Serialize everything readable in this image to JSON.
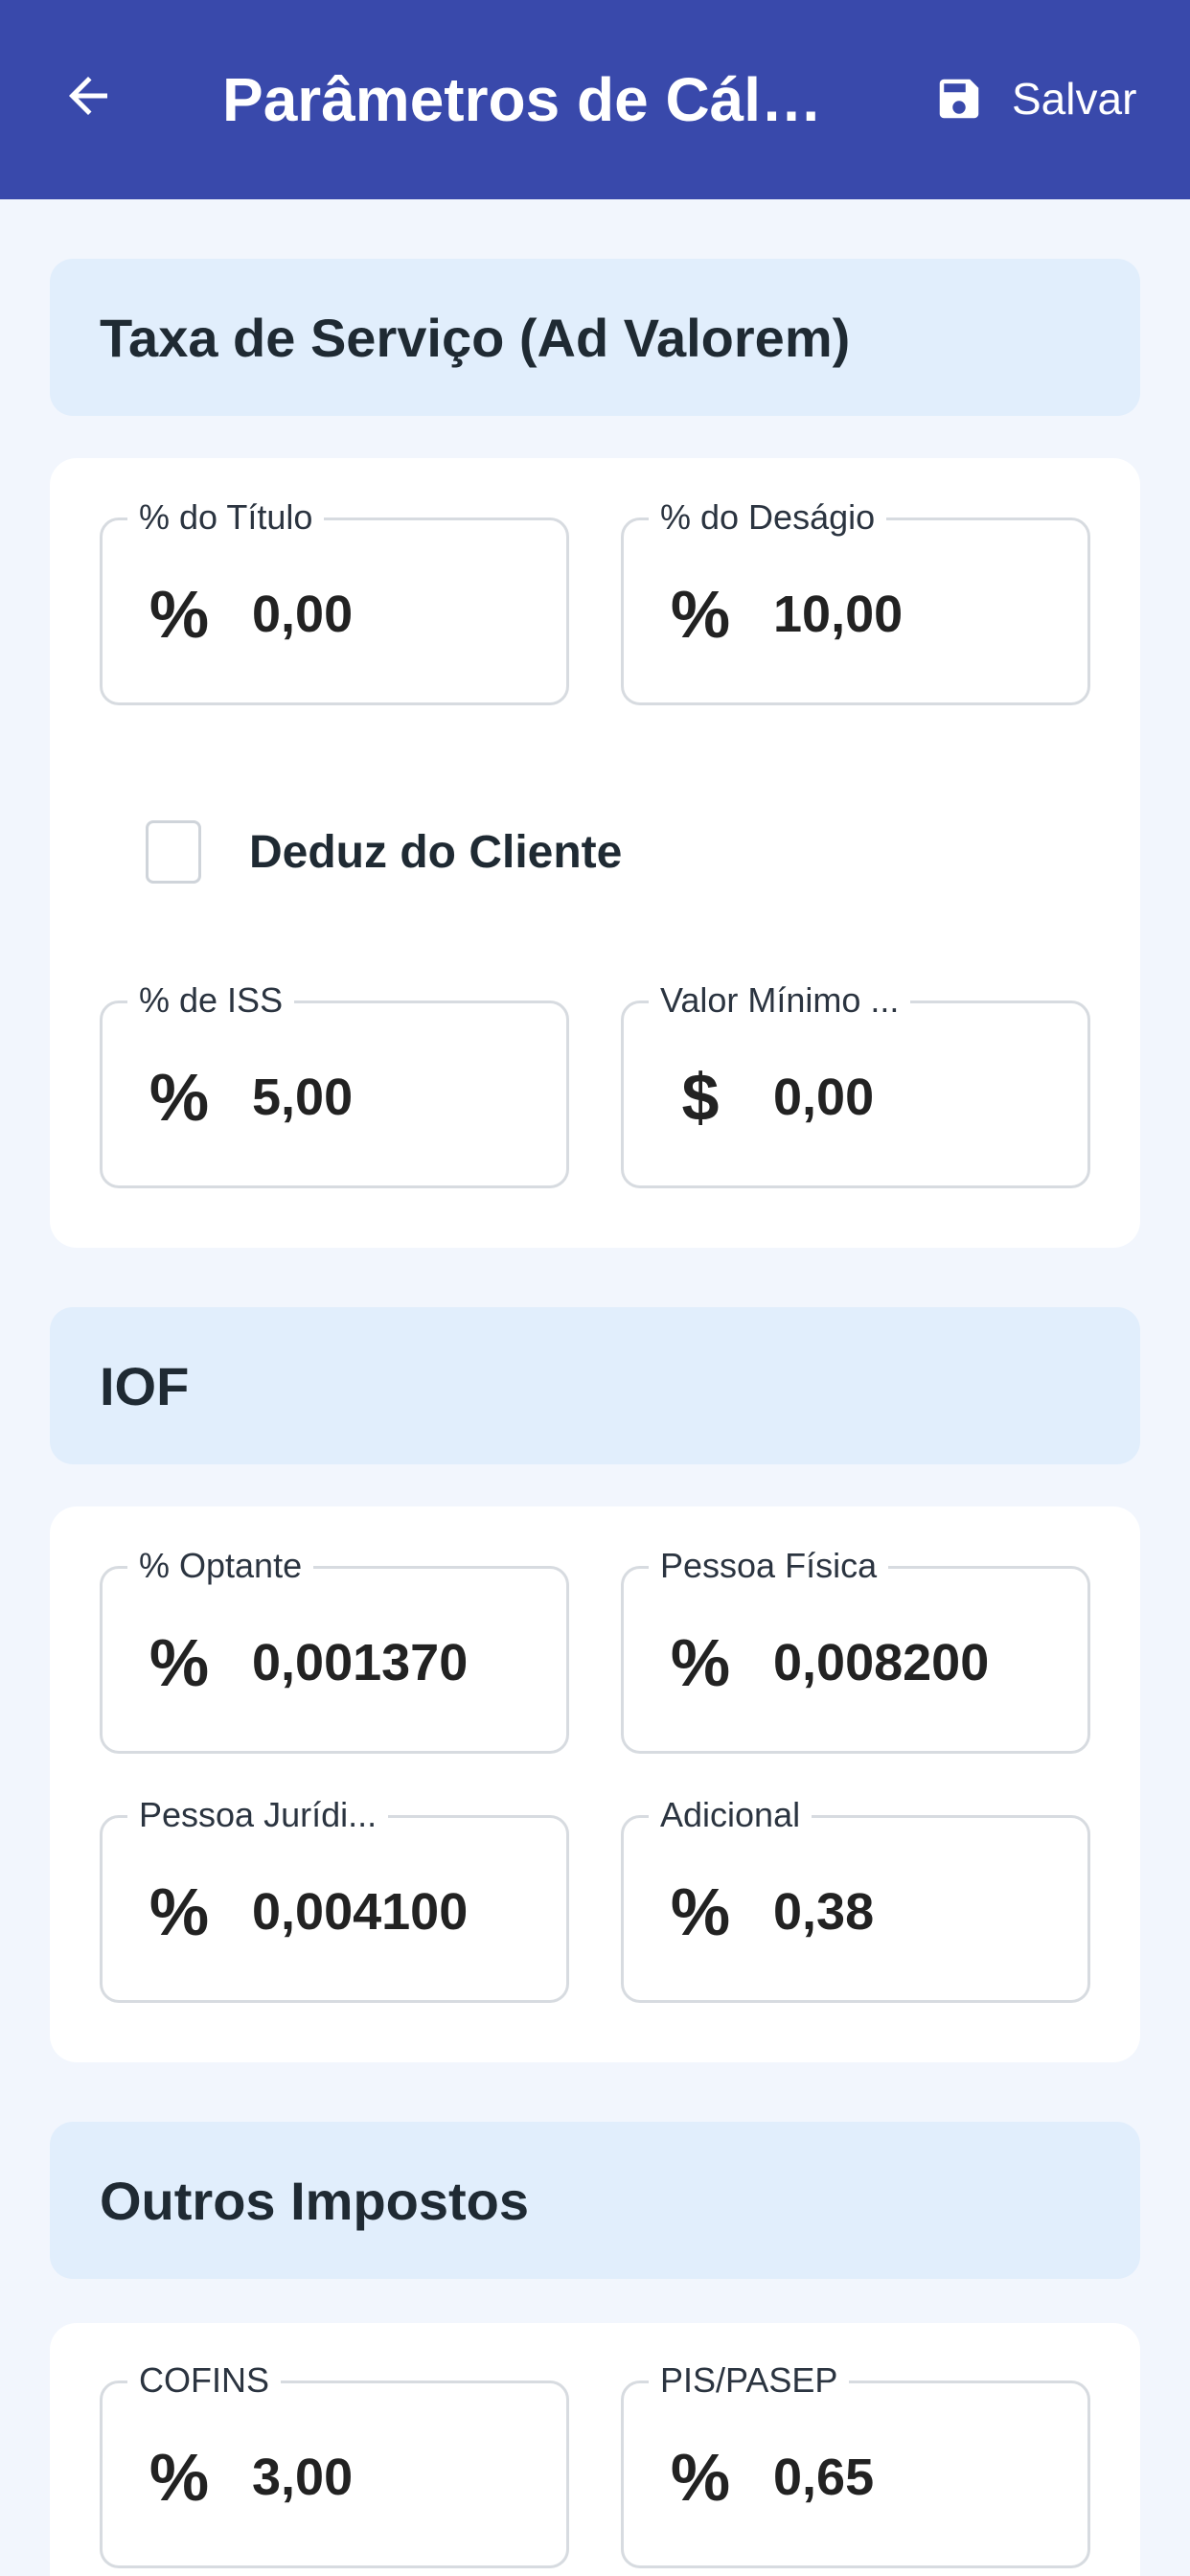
{
  "appbar": {
    "title": "Parâmetros de Cálcu...",
    "save_label": "Salvar",
    "back_icon": "arrow-left-icon",
    "save_icon": "floppy-disk-icon"
  },
  "sections": {
    "taxa": {
      "title": "Taxa de Serviço (Ad Valorem)",
      "fields": {
        "titulo": {
          "label": "% do Título",
          "prefix": "%",
          "value": "0,00"
        },
        "desagio": {
          "label": "% do Deságio",
          "prefix": "%",
          "value": "10,00"
        },
        "iss": {
          "label": "% de ISS",
          "prefix": "%",
          "value": "5,00"
        },
        "valor_minimo": {
          "label": "Valor Mínimo ...",
          "prefix": "$",
          "value": "0,00"
        }
      },
      "checkbox": {
        "label": "Deduz do Cliente",
        "checked": false
      }
    },
    "iof": {
      "title": "IOF",
      "fields": {
        "optante": {
          "label": "% Optante",
          "prefix": "%",
          "value": "0,001370"
        },
        "pessoa_fisica": {
          "label": "Pessoa Física",
          "prefix": "%",
          "value": "0,008200"
        },
        "pessoa_juridica": {
          "label": "Pessoa Jurídi...",
          "prefix": "%",
          "value": "0,004100"
        },
        "adicional": {
          "label": "Adicional",
          "prefix": "%",
          "value": "0,38"
        }
      }
    },
    "outros": {
      "title": "Outros Impostos",
      "fields": {
        "cofins": {
          "label": "COFINS",
          "prefix": "%",
          "value": "3,00"
        },
        "pis": {
          "label": "PIS/PASEP",
          "prefix": "%",
          "value": "0,65"
        }
      }
    }
  },
  "colors": {
    "appbar": "#3949ab",
    "section_header_bg": "#e1eefc",
    "page_bg": "#f2f6fd",
    "card_bg": "#ffffff"
  }
}
